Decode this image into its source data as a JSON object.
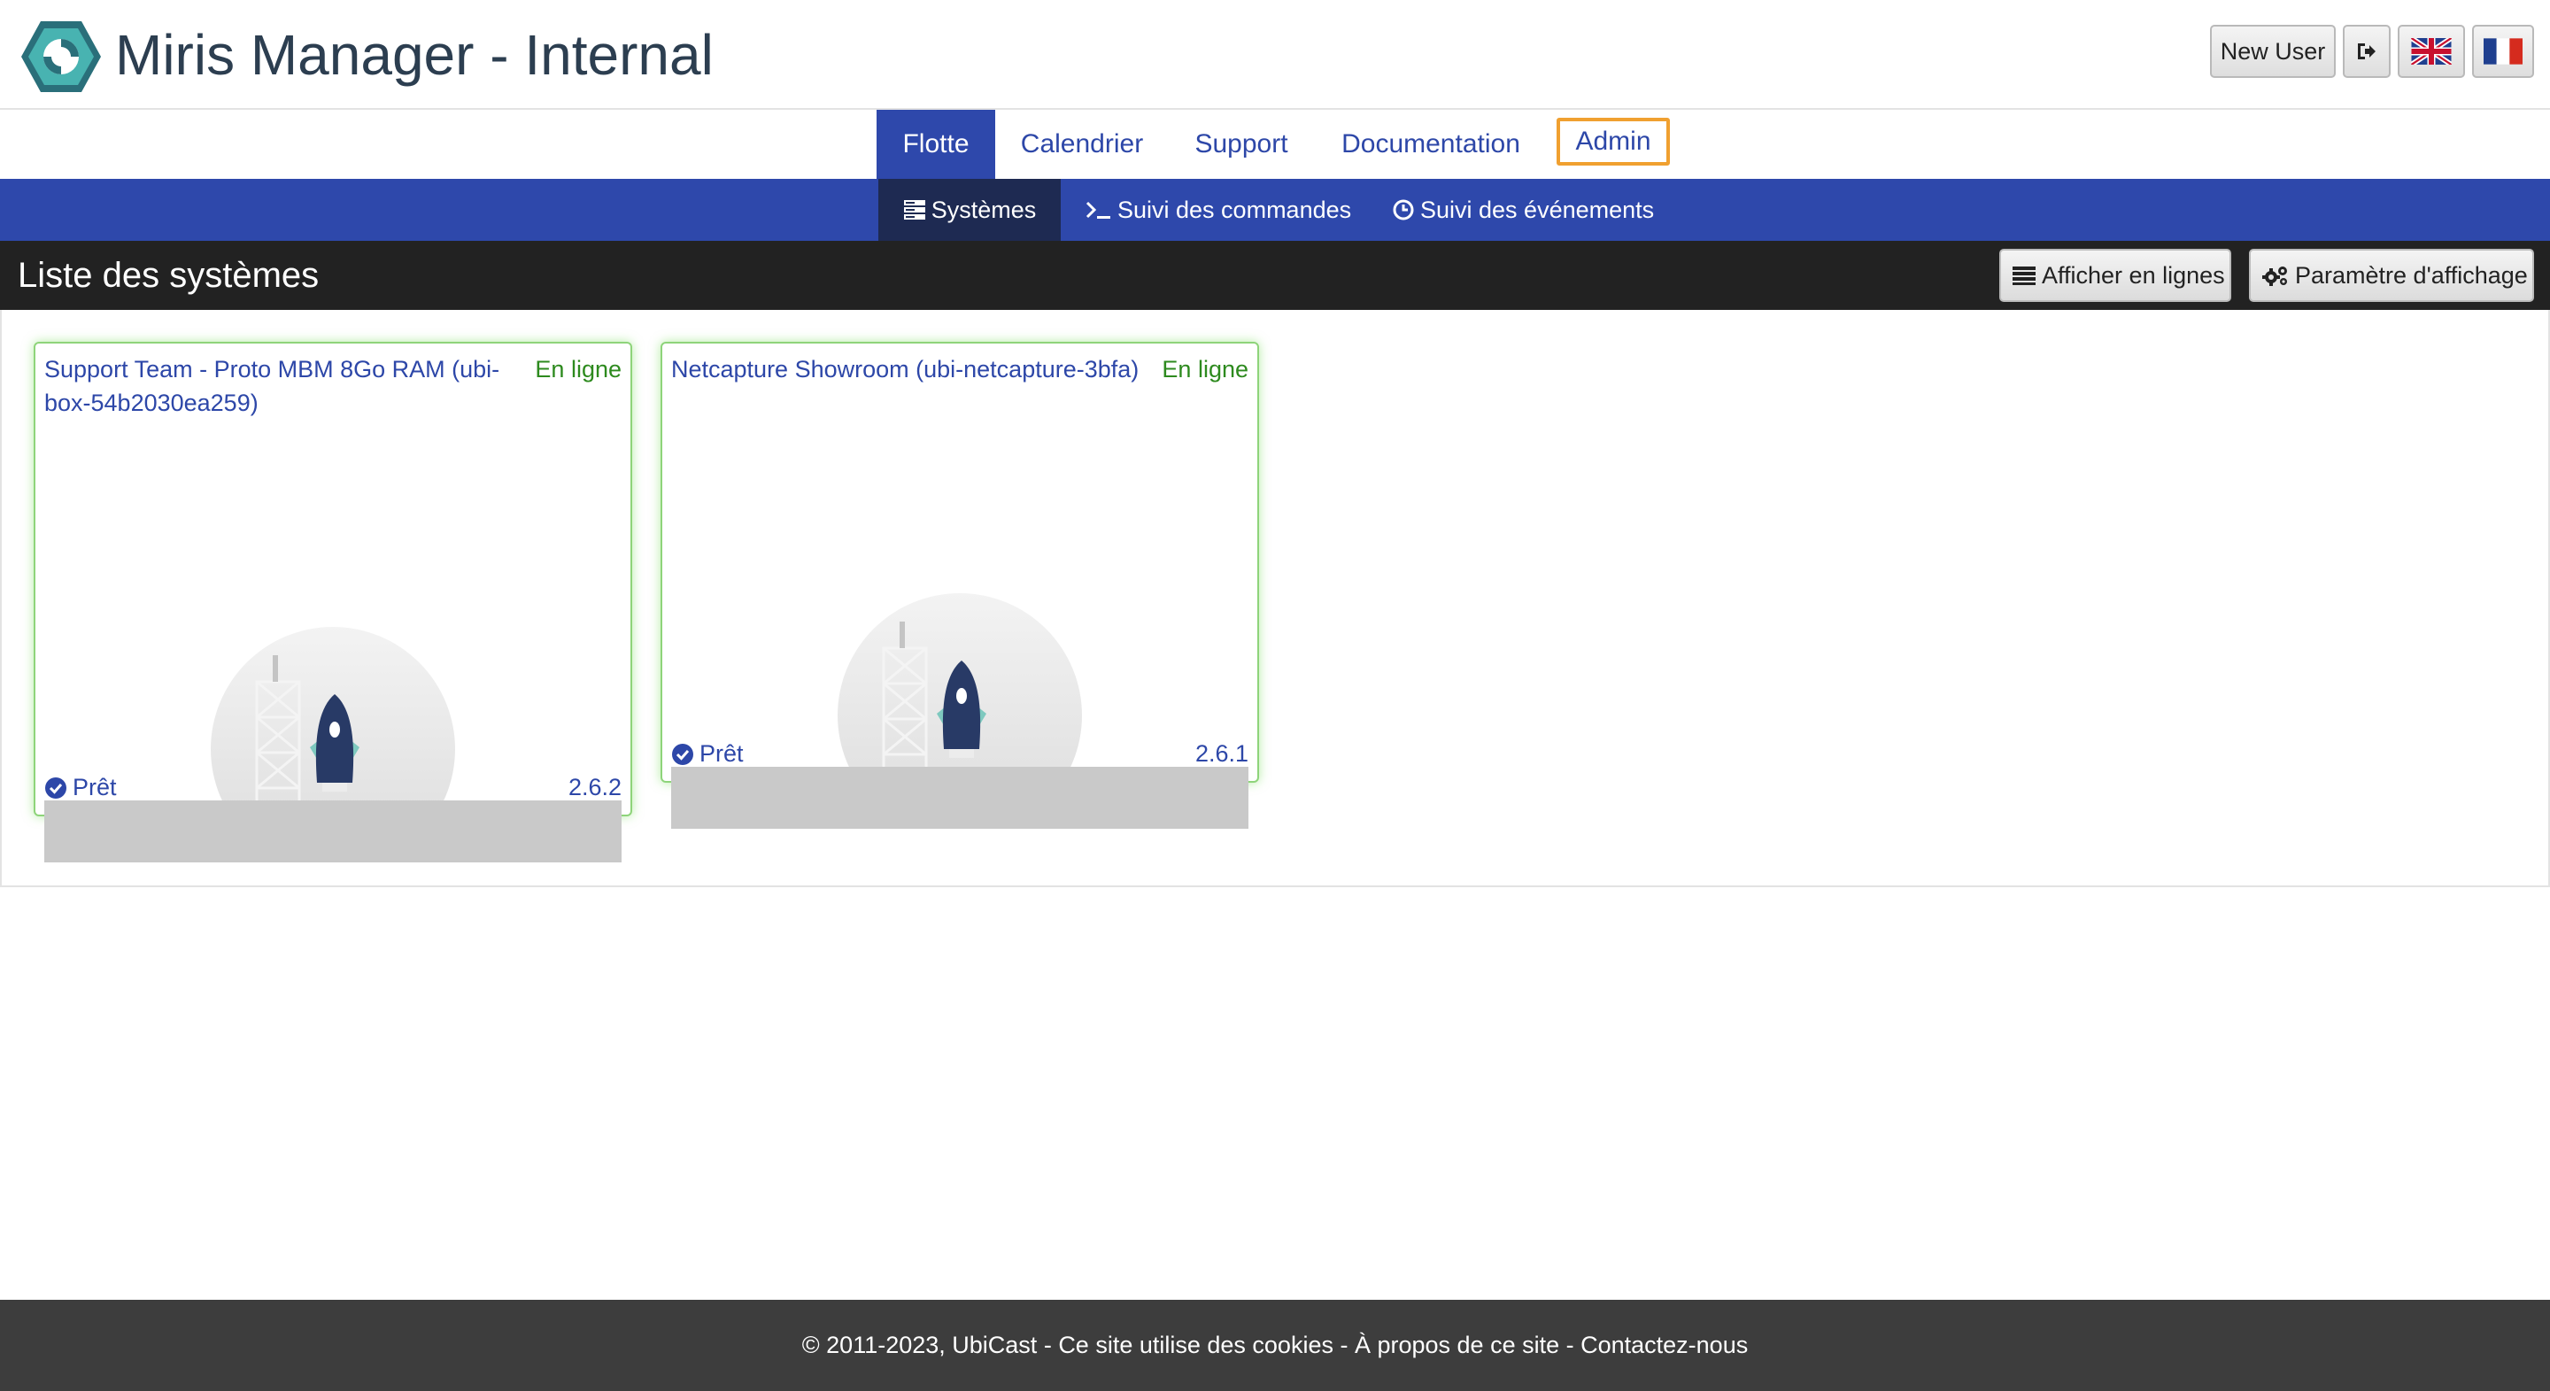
{
  "app": {
    "title": "Miris Manager - Internal"
  },
  "header": {
    "user_label": "New User",
    "logout_icon": "sign-out-icon",
    "language_en_icon": "uk-flag-icon",
    "language_fr_icon": "fr-flag-icon"
  },
  "mainnav": {
    "tabs": [
      {
        "label": "Flotte",
        "active": true
      },
      {
        "label": "Calendrier"
      },
      {
        "label": "Support"
      },
      {
        "label": "Documentation"
      },
      {
        "label": "Admin",
        "highlighted": true
      }
    ]
  },
  "subnav": {
    "tabs": [
      {
        "label": "Systèmes",
        "icon": "server-icon",
        "active": true
      },
      {
        "label": "Suivi des commandes",
        "icon": "terminal-icon"
      },
      {
        "label": "Suivi des événements",
        "icon": "clock-icon"
      }
    ]
  },
  "section": {
    "title": "Liste des systèmes",
    "rows_button": "Afficher en lignes",
    "params_button": "Paramètre d'affichage"
  },
  "systems": [
    {
      "name": "Support Team - Proto MBM 8Go RAM (ubi-box-54b2030ea259)",
      "status": "En ligne",
      "state": "Prêt",
      "version": "2.6.2"
    },
    {
      "name": "Netcapture Showroom (ubi-netcapture-3bfa)",
      "status": "En ligne",
      "state": "Prêt",
      "version": "2.6.1"
    }
  ],
  "footer": {
    "copyright": "© 2011-2023, UbiCast",
    "sep": " - ",
    "cookies": "Ce site utilise des cookies",
    "about": "À propos de ce site",
    "contact": "Contactez-nous"
  },
  "colors": {
    "brand_blue": "#2e48ab",
    "subnav_active": "#1e2a52",
    "section_bar": "#222222",
    "online_green": "#2d8a1e",
    "admin_highlight": "#f0a030",
    "footer_bg": "#3d3d3d"
  }
}
